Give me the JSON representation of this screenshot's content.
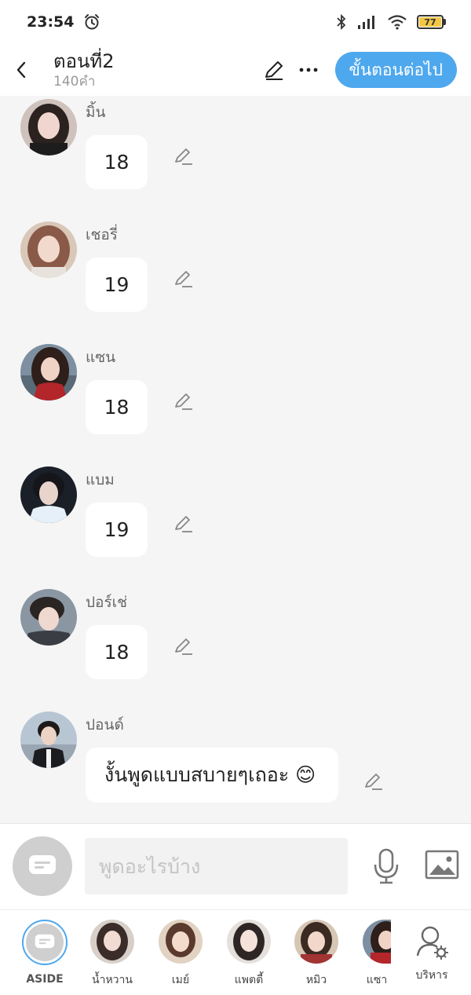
{
  "status_bar": {
    "time": "23:54",
    "battery": "77",
    "icons": [
      "alarm-icon",
      "bluetooth-icon",
      "signal-icon",
      "wifi-icon",
      "battery-icon"
    ]
  },
  "header": {
    "title": "ตอนที่2",
    "word_count": "140คำ",
    "next_button": "ขั้นตอนต่อไป",
    "icons": [
      "back-icon",
      "pencil-icon",
      "more-icon"
    ]
  },
  "messages": [
    {
      "sender": "มิ้น",
      "text": "18"
    },
    {
      "sender": "เชอรี่",
      "text": "19"
    },
    {
      "sender": "แซน",
      "text": "18"
    },
    {
      "sender": "แบม",
      "text": "19"
    },
    {
      "sender": "ปอร์เช่",
      "text": "18"
    },
    {
      "sender": "ปอนด์",
      "text": "งั้นพูดแบบสบายๆเถอะ 😊"
    }
  ],
  "input": {
    "placeholder": "พูดอะไรบ้าง",
    "icons": [
      "aside-chat-icon",
      "microphone-icon",
      "image-icon"
    ]
  },
  "characters": [
    {
      "label": "ASIDE",
      "selected": true
    },
    {
      "label": "น้ำหวาน"
    },
    {
      "label": "เมย์"
    },
    {
      "label": "แพตตี้"
    },
    {
      "label": "หมิว"
    },
    {
      "label": "แซา"
    }
  ],
  "manage_label": "บริหาร",
  "colors": {
    "accent": "#4ea8ee",
    "background": "#f5f5f5",
    "bubble": "#ffffff",
    "battery": "#f2c744"
  }
}
